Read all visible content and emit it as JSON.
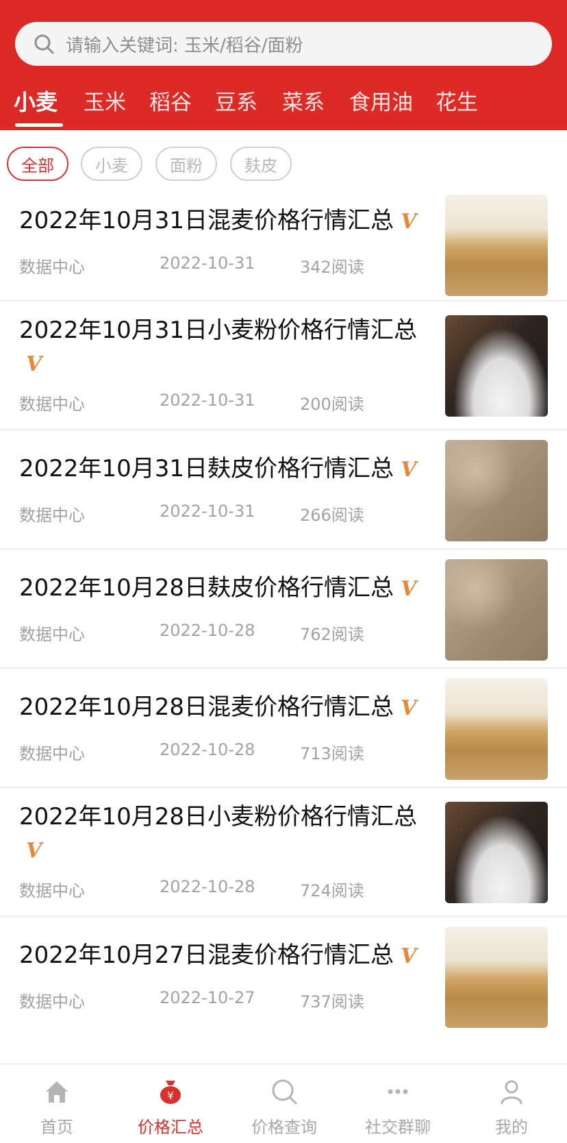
{
  "search": {
    "placeholder": "请输入关键词: 玉米/稻谷/面粉"
  },
  "categories": [
    {
      "label": "小麦",
      "active": true
    },
    {
      "label": "玉米"
    },
    {
      "label": "稻谷"
    },
    {
      "label": "豆系"
    },
    {
      "label": "菜系"
    },
    {
      "label": "食用油"
    },
    {
      "label": "花生"
    }
  ],
  "filters": [
    {
      "label": "全部",
      "active": true
    },
    {
      "label": "小麦"
    },
    {
      "label": "面粉"
    },
    {
      "label": "麸皮"
    }
  ],
  "articles": [
    {
      "title": "2022年10月31日混麦价格行情汇总",
      "badge": "V",
      "source": "数据中心",
      "date": "2022-10-31",
      "reads": "342阅读",
      "thumb": "wheat"
    },
    {
      "title": "2022年10月31日小麦粉价格行情汇总",
      "badge": "V",
      "source": "数据中心",
      "date": "2022-10-31",
      "reads": "200阅读",
      "thumb": "flour"
    },
    {
      "title": "2022年10月31日麸皮价格行情汇总",
      "badge": "V",
      "source": "数据中心",
      "date": "2022-10-31",
      "reads": "266阅读",
      "thumb": "bran"
    },
    {
      "title": "2022年10月28日麸皮价格行情汇总",
      "badge": "V",
      "source": "数据中心",
      "date": "2022-10-28",
      "reads": "762阅读",
      "thumb": "bran"
    },
    {
      "title": "2022年10月28日混麦价格行情汇总",
      "badge": "V",
      "source": "数据中心",
      "date": "2022-10-28",
      "reads": "713阅读",
      "thumb": "wheat"
    },
    {
      "title": "2022年10月28日小麦粉价格行情汇总",
      "badge": "V",
      "source": "数据中心",
      "date": "2022-10-28",
      "reads": "724阅读",
      "thumb": "flour"
    },
    {
      "title": "2022年10月27日混麦价格行情汇总",
      "badge": "V",
      "source": "数据中心",
      "date": "2022-10-27",
      "reads": "737阅读",
      "thumb": "wheat"
    }
  ],
  "tabbar": [
    {
      "label": "首页",
      "icon": "home-icon"
    },
    {
      "label": "价格汇总",
      "icon": "money-bag-icon",
      "active": true
    },
    {
      "label": "价格查询",
      "icon": "search-icon"
    },
    {
      "label": "社交群聊",
      "icon": "chat-dots-icon"
    },
    {
      "label": "我的",
      "icon": "user-icon"
    }
  ],
  "colors": {
    "brand_red": "#dc2b27",
    "badge_orange": "#e58a38",
    "muted_text": "#a2a2a2"
  }
}
